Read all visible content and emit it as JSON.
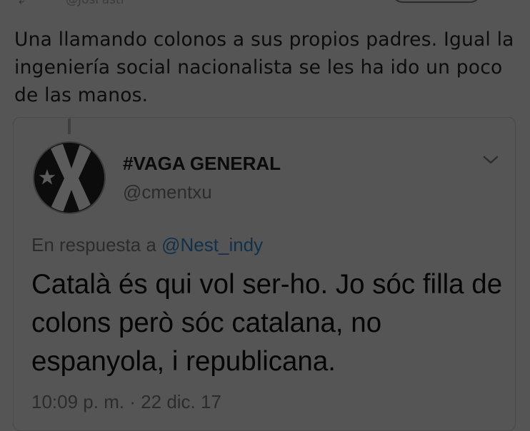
{
  "top": {
    "handle": "@JosPasti",
    "reply_glyph": "⤶"
  },
  "tweet": {
    "text": "Una llamando colonos a sus propios padres. Igual la ingeniería social nacionalista se les ha ido un poco de las manos."
  },
  "quoted": {
    "display_name": "#VAGA GENERAL",
    "handle": "@cmentxu",
    "reply_prefix": "En respuesta a",
    "reply_to": "@Nest_indy",
    "text": "Català és qui vol ser-ho. Jo sóc filla de colons però sóc catalana, no espanyola, i republicana.",
    "timestamp": "10:09 p. m. · 22 dic. 17"
  },
  "icons": {
    "avatar": "avatar-x-star-icon",
    "more": "chevron-down-icon",
    "top_left": "reply-arrow-icon"
  },
  "colors": {
    "background": "#555555",
    "link": "#12304a"
  }
}
